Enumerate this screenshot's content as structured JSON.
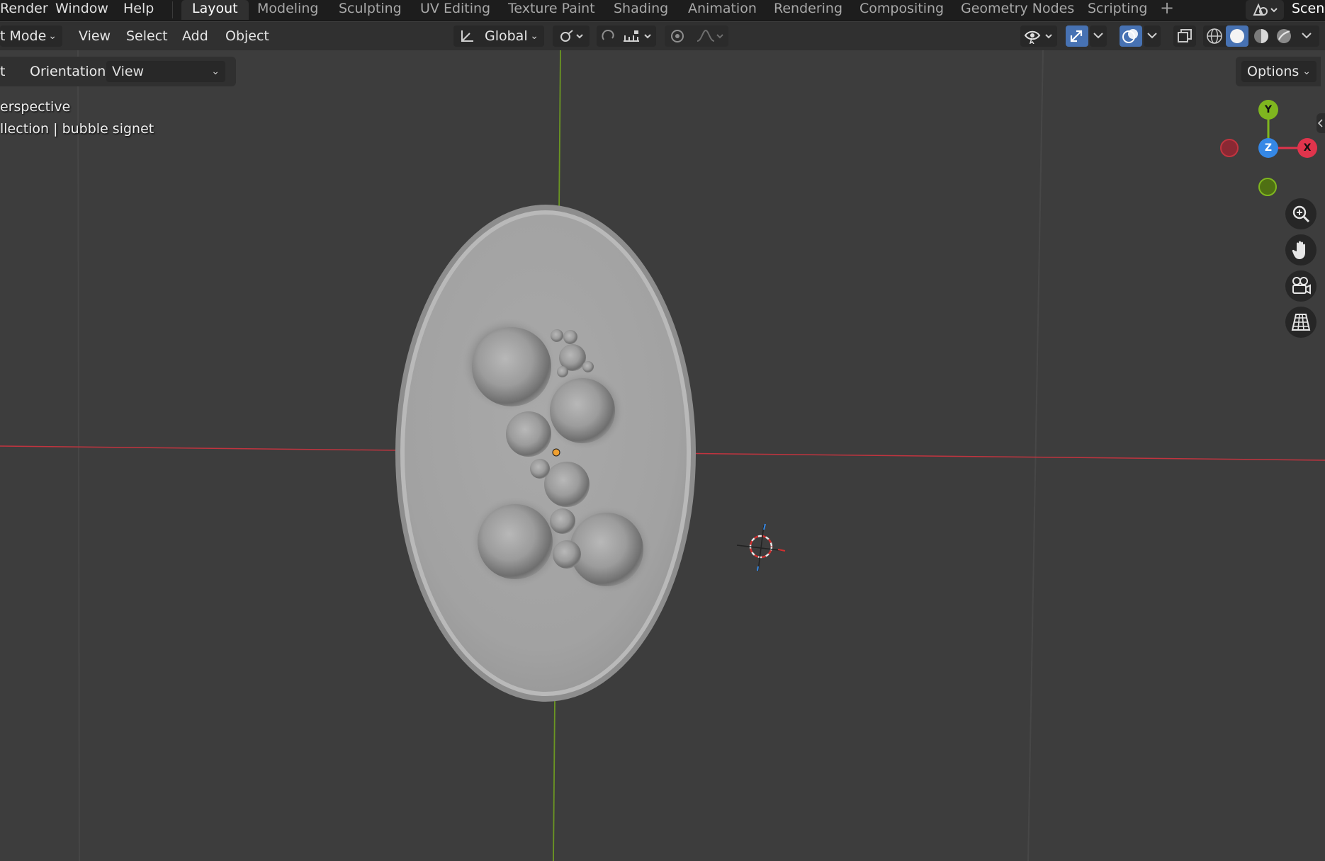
{
  "topbar": {
    "menus": [
      "Render",
      "Window",
      "Help"
    ],
    "workspaces": [
      "Layout",
      "Modeling",
      "Sculpting",
      "UV Editing",
      "Texture Paint",
      "Shading",
      "Animation",
      "Rendering",
      "Compositing",
      "Geometry Nodes",
      "Scripting"
    ],
    "active_workspace": "Layout",
    "add_tab": "+",
    "scene_label": "Scen"
  },
  "header": {
    "mode_label": "t Mode",
    "menus": [
      "View",
      "Select",
      "Add",
      "Object"
    ],
    "transform_orientation": "Global"
  },
  "tool_settings": {
    "partial_label": "t",
    "orientation_label": "Orientation:",
    "orientation_value": "View",
    "options_label": "Options"
  },
  "viewport": {
    "view_name": "erspective",
    "collection_info": "llection | bubble signet",
    "gizmo": {
      "y_label": "Y",
      "z_label": "Z",
      "x_label": "X",
      "colors": {
        "x": "#e0344c",
        "y": "#7fb61f",
        "z": "#3588e6"
      }
    }
  },
  "icons": {
    "header_right": [
      "visibility-icon",
      "gizmo-icon",
      "overlay-icon",
      "xray-icon",
      "wireframe-shading-icon",
      "solid-shading-icon",
      "material-shading-icon",
      "rendered-shading-icon"
    ],
    "nav": [
      "zoom-icon",
      "pan-hand-icon",
      "camera-view-icon",
      "perspective-grid-icon"
    ]
  },
  "colors": {
    "accent": "#4772b3",
    "background": "#3d3d3d",
    "x_axis_line": "#c1343f",
    "y_axis_line": "#6b9622"
  }
}
